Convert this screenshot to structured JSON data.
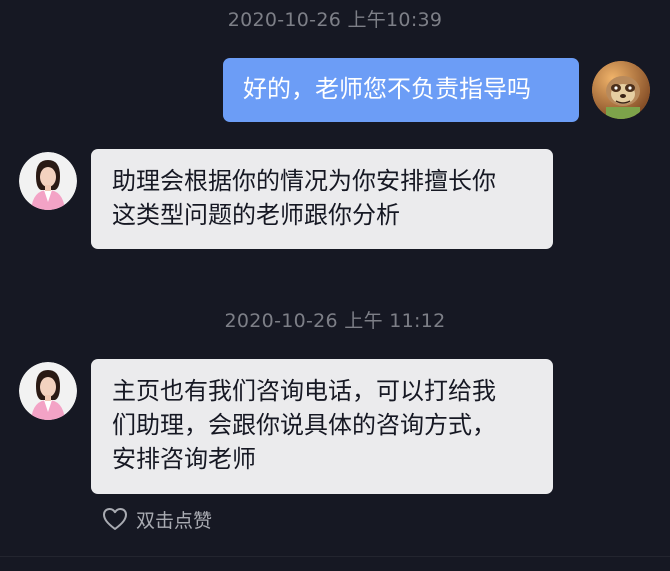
{
  "messages": [
    {
      "type": "timestamp",
      "text": "2020-10-26 上午10:39"
    },
    {
      "type": "outgoing",
      "sender_avatar": "user-avatar-sloth",
      "text": "好的，老师您不负责指导吗"
    },
    {
      "type": "incoming",
      "sender_avatar": "agent-avatar",
      "text": "助理会根据你的情况为你安排擅长你\n这类型问题的老师跟你分析"
    },
    {
      "type": "timestamp",
      "text": "2020-10-26 上午 11:12"
    },
    {
      "type": "incoming",
      "sender_avatar": "agent-avatar",
      "text": "主页也有我们咨询电话，可以打给我\n们助理，会跟你说具体的咨询方式，\n安排咨询老师"
    }
  ],
  "like_action": {
    "icon": "heart-outline-icon",
    "label": "双击点赞"
  },
  "colors": {
    "background": "#161823",
    "outgoing_bubble": "#6c9df6",
    "incoming_bubble": "#ebebed",
    "timestamp_text": "#7d7f87"
  }
}
